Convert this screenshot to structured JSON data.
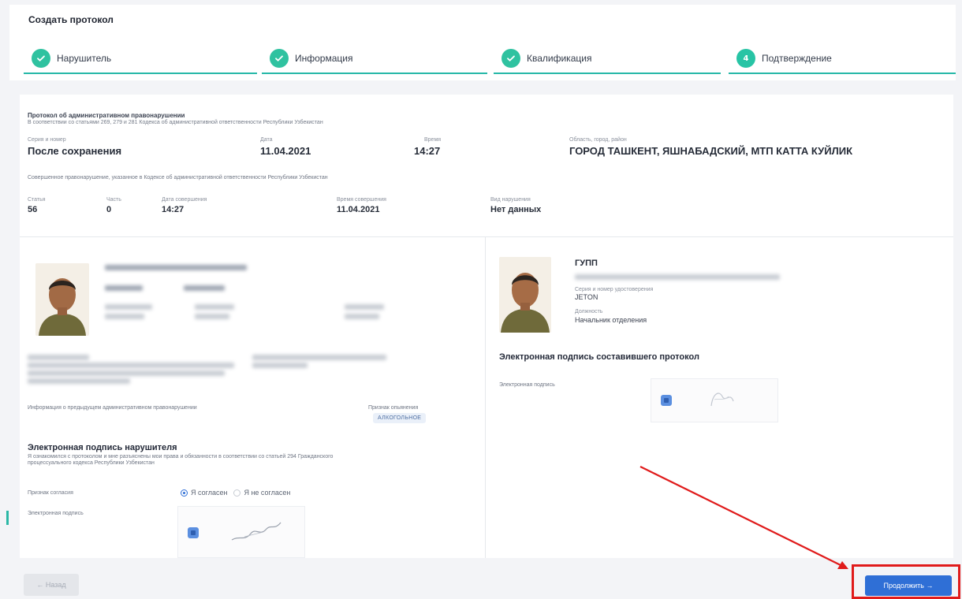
{
  "page_title": "Создать протокол",
  "stepper": [
    {
      "label": "Нарушитель",
      "state": "done"
    },
    {
      "label": "Информация",
      "state": "done"
    },
    {
      "label": "Квалификация",
      "state": "done"
    },
    {
      "label": "Подтверждение",
      "state": "current",
      "number": "4"
    }
  ],
  "protocol": {
    "title": "Протокол об административном правонарушении",
    "subtitle": "В соответствии со статьями 269, 279 и 281 Кодекса об административной ответственности Республики Узбекистан",
    "series_label": "Серия и номер",
    "series_value": "После сохранения",
    "date_label": "Дата",
    "date_value": "11.04.2021",
    "time_label": "Время",
    "time_value": "14:27",
    "region_label": "Область, город, район",
    "region_value": "ГОРОД ТАШКЕНТ, ЯШНАБАДСКИЙ, МТП КАТТА КУЙЛИК",
    "offense_note": "Совершенное правонарушение, указанное в Кодексе об административной ответственности Республики Узбекистан",
    "article_label": "Статья",
    "article_value": "56",
    "part_label": "Часть",
    "part_value": "0",
    "commit_date_label": "Дата совершения",
    "commit_date_value": "14:27",
    "commit_time_label": "Время совершения",
    "commit_time_value": "11.04.2021",
    "violation_type_label": "Вид нарушения",
    "violation_type_value": "Нет данных"
  },
  "violator": {
    "prev_info_label": "Информация о предыдущем административном правонарушении",
    "intox_label": "Признак опьянения",
    "intox_value": "АЛКОГОЛЬНОЕ",
    "sig_title": "Электронная подпись нарушителя",
    "sig_note_1": "Я ознакомился с протоколом и мне разъяснены мои права и обязанности в соответствии со статьей 294 Гражданского",
    "sig_note_2": "процессуального кодекса Республики Узбекистан",
    "consent_label": "Признак согласия",
    "consent_yes": "Я согласен",
    "consent_no": "Я не согласен",
    "esign_label": "Электронная подпись"
  },
  "officer": {
    "unit": "ГУПП",
    "cert_label": "Серия и номер удостоверения",
    "cert_value": "JETON",
    "position_label": "Должность",
    "position_value": "Начальник отделения",
    "sig_title": "Электронная подпись составившего протокол",
    "esign_label": "Электронная подпись"
  },
  "footer": {
    "back_label": "← Назад",
    "next_label": "Продолжить →"
  },
  "colors": {
    "accent": "#2fc2a0",
    "primary": "#2f6fd6",
    "annotation": "#e01b1b"
  }
}
